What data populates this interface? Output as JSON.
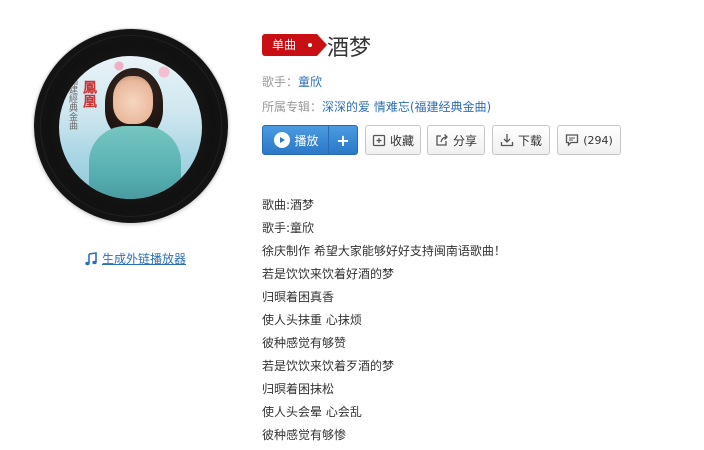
{
  "badge": {
    "label": "单曲"
  },
  "song": {
    "title": "酒梦"
  },
  "singer": {
    "label": "歌手：",
    "name": "童欣"
  },
  "album": {
    "label": "所属专辑：",
    "name": "深深的爱 情难忘(福建经典金曲)"
  },
  "cover": {
    "title_text": "鳳凰",
    "side_text": "福建經典金曲"
  },
  "embed": {
    "label": "生成外链播放器"
  },
  "actions": {
    "play": "播放",
    "add": "+",
    "favorite": "收藏",
    "share": "分享",
    "download": "下载",
    "comment_count": "(294)"
  },
  "lyrics": [
    "歌曲:酒梦",
    "歌手:童欣",
    "徐庆制作 希望大家能够好好支持闽南语歌曲！",
    "若是饮饮来饮着好酒的梦",
    "归暝着困真香",
    "使人头抹重 心抹烦",
    "彼种感觉有够赞",
    "若是饮饮来饮着歹酒的梦",
    "归暝着困抹松",
    "使人头会晕 心会乱",
    "彼种感觉有够惨"
  ],
  "colors": {
    "badge_red": "#c80f13",
    "link_blue": "#2d6fb6",
    "play_blue": "#2b78c8"
  },
  "icons": [
    "music-note-icon",
    "play-icon",
    "plus-icon",
    "favorite-icon",
    "share-icon",
    "download-icon",
    "comment-icon"
  ]
}
